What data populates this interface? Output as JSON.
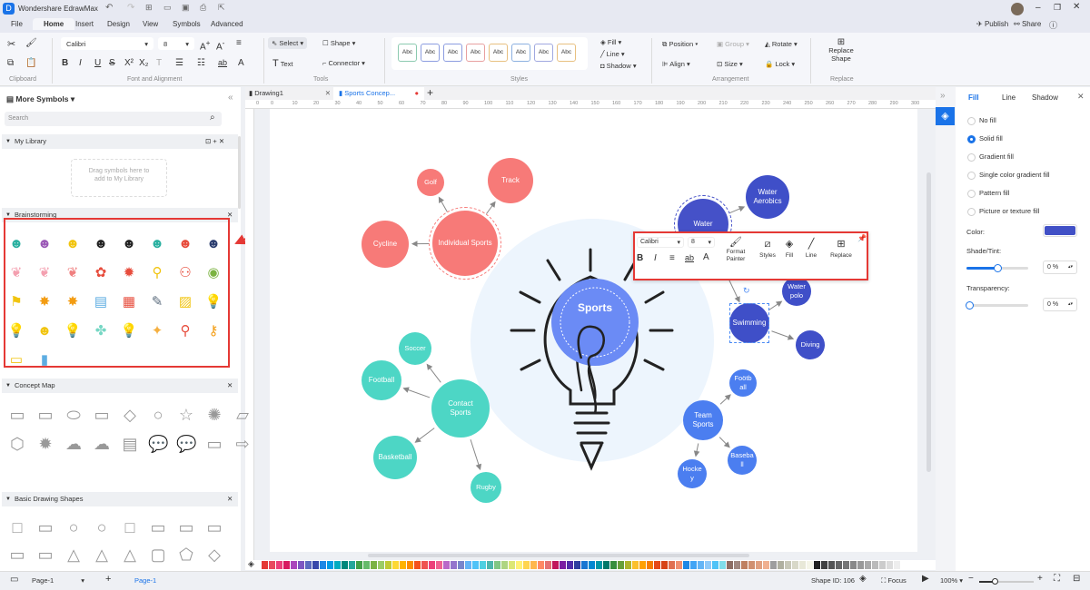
{
  "app": {
    "title": "Wondershare EdrawMax"
  },
  "header": {
    "publish": "Publish",
    "share": "Share"
  },
  "menu": {
    "tabs": [
      "File",
      "Home",
      "Insert",
      "Design",
      "View",
      "Symbols",
      "Advanced"
    ],
    "active": "Home"
  },
  "ribbon": {
    "font": "Calibri",
    "size": "8",
    "select": "Select",
    "shape": "Shape",
    "text": "Text",
    "connector": "Connector",
    "style_sample": "Abc",
    "fill": "Fill",
    "line": "Line",
    "shadow": "Shadow",
    "position": "Position",
    "group": "Group",
    "rotate": "Rotate",
    "align": "Align",
    "size_label": "Size",
    "lock": "Lock",
    "replace_shape": "Replace Shape",
    "groups": {
      "clipboard": "Clipboard",
      "font": "Font and Alignment",
      "tools": "Tools",
      "styles": "Styles",
      "arrangement": "Arrangement",
      "replace": "Replace"
    }
  },
  "left_panel": {
    "title": "More Symbols",
    "search_placeholder": "Search",
    "my_library": "My Library",
    "drop_hint": "Drag symbols here to add to My Library",
    "sections": [
      "Brainstorming",
      "Concept Map",
      "Basic Drawing Shapes"
    ]
  },
  "doc_tabs": [
    {
      "label": "Drawing1"
    },
    {
      "label": "Sports Concep..."
    }
  ],
  "ruler": [
    "0",
    "0",
    "10",
    "20",
    "30",
    "40",
    "50",
    "60",
    "70",
    "80",
    "90",
    "100",
    "110",
    "120",
    "130",
    "140",
    "150",
    "160",
    "170",
    "180",
    "190",
    "200",
    "210",
    "220",
    "230",
    "240",
    "250",
    "260",
    "270",
    "280",
    "290",
    "300"
  ],
  "diagram": {
    "center": "Sports",
    "nodes": [
      {
        "id": "individual",
        "label": "Individual Sports"
      },
      {
        "id": "golf",
        "label": "Golf"
      },
      {
        "id": "track",
        "label": "Track"
      },
      {
        "id": "cycline",
        "label": "Cycline"
      },
      {
        "id": "water",
        "label": "Water"
      },
      {
        "id": "aerobics",
        "label": "Water Aerobics"
      },
      {
        "id": "polo",
        "label": "Water polo"
      },
      {
        "id": "swimming",
        "label": "Swimming"
      },
      {
        "id": "diving",
        "label": "Diving"
      },
      {
        "id": "contact",
        "label": "Contact Sports"
      },
      {
        "id": "soccer",
        "label": "Soccer"
      },
      {
        "id": "football",
        "label": "Football"
      },
      {
        "id": "basketball",
        "label": "Basketball"
      },
      {
        "id": "rugby",
        "label": "Rugby"
      },
      {
        "id": "team",
        "label": "Team Sports"
      },
      {
        "id": "football2",
        "label": "Foötb all"
      },
      {
        "id": "baseball",
        "label": "Baseba ll"
      },
      {
        "id": "hockey",
        "label": "Hocke y"
      }
    ]
  },
  "floating_toolbar": {
    "font": "Calibri",
    "size": "8",
    "format_painter": "Format Painter",
    "styles": "Styles",
    "fill": "Fill",
    "line": "Line",
    "replace": "Replace"
  },
  "right_panel": {
    "tabs": [
      "Fill",
      "Line",
      "Shadow"
    ],
    "active": "Fill",
    "options": [
      "No fill",
      "Solid fill",
      "Gradient fill",
      "Single color gradient fill",
      "Pattern fill",
      "Picture or texture fill"
    ],
    "selected": "Solid fill",
    "color_label": "Color:",
    "color": "#4150c6",
    "shade_label": "Shade/Tint:",
    "shade_value": "0 %",
    "shade_slider": 0.5,
    "transparency_label": "Transparency:",
    "transparency_value": "0 %",
    "transparency_slider": 0
  },
  "status": {
    "page_selector": "Page-1",
    "page_tab": "Page-1",
    "shape_id": "Shape ID: 106",
    "focus": "Focus",
    "zoom": "100%"
  },
  "colors": {
    "accent": "#1a73e8",
    "highlight": "#e53935"
  }
}
